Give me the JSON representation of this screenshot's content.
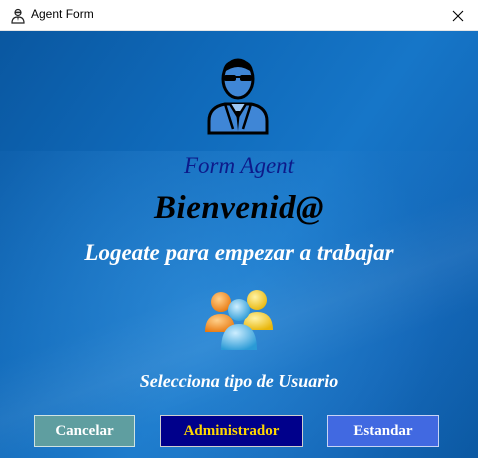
{
  "window": {
    "title": "Agent Form"
  },
  "content": {
    "form_title": "Form Agent",
    "welcome": "Bienvenid@",
    "subtitle": "Logeate para empezar a trabajar",
    "select_label": "Selecciona tipo de Usuario"
  },
  "buttons": {
    "cancel": "Cancelar",
    "admin": "Administrador",
    "standard": "Estandar"
  },
  "icons": {
    "app": "agent-small-icon",
    "close": "close-icon",
    "agent": "agent-avatar-icon",
    "users": "user-group-icon"
  },
  "colors": {
    "background": "#1273c4",
    "form_title": "#0d1a8a",
    "cancel_bg": "#5f9ea0",
    "admin_bg": "#00008b",
    "admin_text": "#ffd700",
    "standard_bg": "#4169e1"
  }
}
